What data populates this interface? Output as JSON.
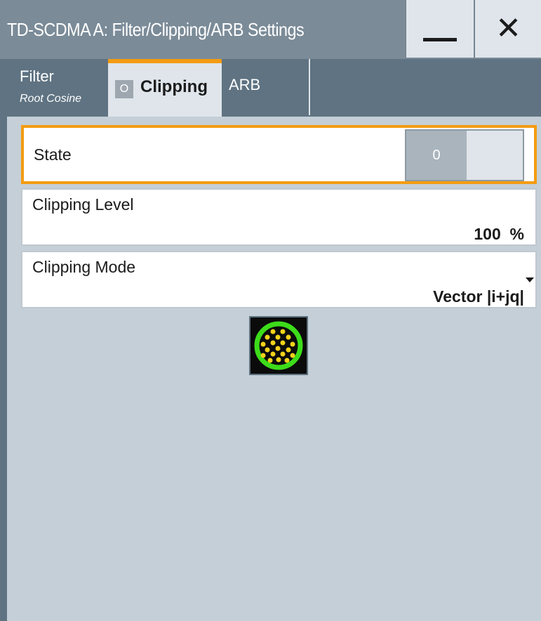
{
  "window": {
    "title": "TD-SCDMA A: Filter/Clipping/ARB Settings",
    "minimize_icon": "minimize-icon",
    "close_icon": "close-icon",
    "close_label": "✕"
  },
  "tabs": [
    {
      "label": "Filter",
      "sublabel": "Root Cosine"
    },
    {
      "label": "Clipping",
      "state_indicator": "O",
      "active": true
    },
    {
      "label": "ARB"
    }
  ],
  "state": {
    "label": "State",
    "toggle_value": "0"
  },
  "clipping_level": {
    "label": "Clipping Level",
    "value": "100  %"
  },
  "clipping_mode": {
    "label": "Clipping Mode",
    "value": "Vector |i+jq|"
  },
  "graphic": {
    "icon": "clipping-vector-graphic-icon"
  },
  "colors": {
    "accent": "#f39c12",
    "titlebar": "#7b8b98",
    "tabstrip": "#5f7382",
    "panel_bg": "#ffffff",
    "body_bg": "#c5cfd7",
    "graphic_ring": "#3ddc1a",
    "graphic_dots": "#f1d21a"
  }
}
